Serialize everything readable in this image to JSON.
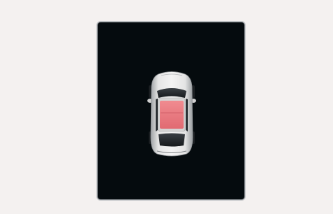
{
  "screen": {
    "background": "#050b0e",
    "border_color": "#8f9498"
  },
  "vehicle": {
    "view": "top-down",
    "icon": "car-top-view-icon",
    "body_color": "#d9d9d9",
    "highlight_zone": "sunroof",
    "highlight_color": "#e8737a",
    "highlight_active": true
  }
}
